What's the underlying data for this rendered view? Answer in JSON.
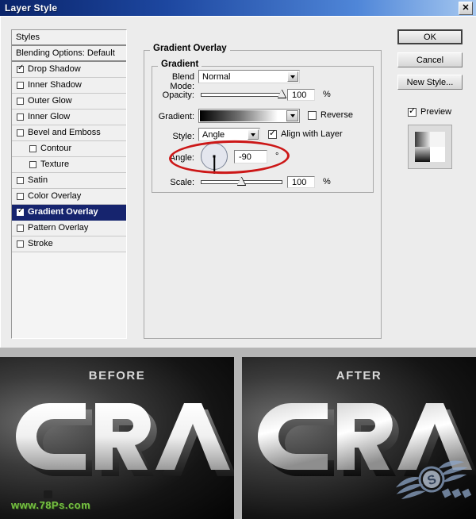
{
  "window": {
    "title": "Layer Style",
    "close_label": "✕"
  },
  "styles_panel": {
    "header_label": "Styles",
    "blending_label": "Blending Options: Default",
    "effects": [
      {
        "label": "Drop Shadow",
        "checked": true,
        "sub": false,
        "selected": false
      },
      {
        "label": "Inner Shadow",
        "checked": false,
        "sub": false,
        "selected": false
      },
      {
        "label": "Outer Glow",
        "checked": false,
        "sub": false,
        "selected": false
      },
      {
        "label": "Inner Glow",
        "checked": false,
        "sub": false,
        "selected": false
      },
      {
        "label": "Bevel and Emboss",
        "checked": false,
        "sub": false,
        "selected": false
      },
      {
        "label": "Contour",
        "checked": false,
        "sub": true,
        "selected": false
      },
      {
        "label": "Texture",
        "checked": false,
        "sub": true,
        "selected": false
      },
      {
        "label": "Satin",
        "checked": false,
        "sub": false,
        "selected": false
      },
      {
        "label": "Color Overlay",
        "checked": false,
        "sub": false,
        "selected": false
      },
      {
        "label": "Gradient Overlay",
        "checked": true,
        "sub": false,
        "selected": true
      },
      {
        "label": "Pattern Overlay",
        "checked": false,
        "sub": false,
        "selected": false
      },
      {
        "label": "Stroke",
        "checked": false,
        "sub": false,
        "selected": false
      }
    ]
  },
  "gradient_overlay": {
    "group_title": "Gradient Overlay",
    "inner_title": "Gradient",
    "blend_mode": {
      "label": "Blend Mode:",
      "value": "Normal"
    },
    "opacity": {
      "label": "Opacity:",
      "value": "100",
      "unit": "%",
      "percent": 100
    },
    "gradient": {
      "label": "Gradient:",
      "from": "#000000",
      "to": "#ffffff"
    },
    "reverse": {
      "label": "Reverse",
      "checked": false
    },
    "style": {
      "label": "Style:",
      "value": "Angle"
    },
    "align": {
      "label": "Align with Layer",
      "checked": true
    },
    "angle": {
      "label": "Angle:",
      "value": "-90",
      "unit": "°",
      "degrees": -90
    },
    "scale": {
      "label": "Scale:",
      "value": "100",
      "unit": "%",
      "percent": 50
    }
  },
  "buttons": {
    "ok": "OK",
    "cancel": "Cancel",
    "new_style": "New Style...",
    "preview": {
      "label": "Preview",
      "checked": true
    }
  },
  "comparison": {
    "before": {
      "caption": "BEFORE",
      "text": "CRA",
      "watermark": "www.78Ps.com"
    },
    "after": {
      "caption": "AFTER",
      "text": "CRA"
    }
  },
  "colors": {
    "titlebar_start": "#0a246a",
    "titlebar_end": "#a6c8f0",
    "dialog_bg": "#ececec",
    "selection": "#16246e",
    "annotation": "#cc1717",
    "watermark_green": "#76c043"
  }
}
